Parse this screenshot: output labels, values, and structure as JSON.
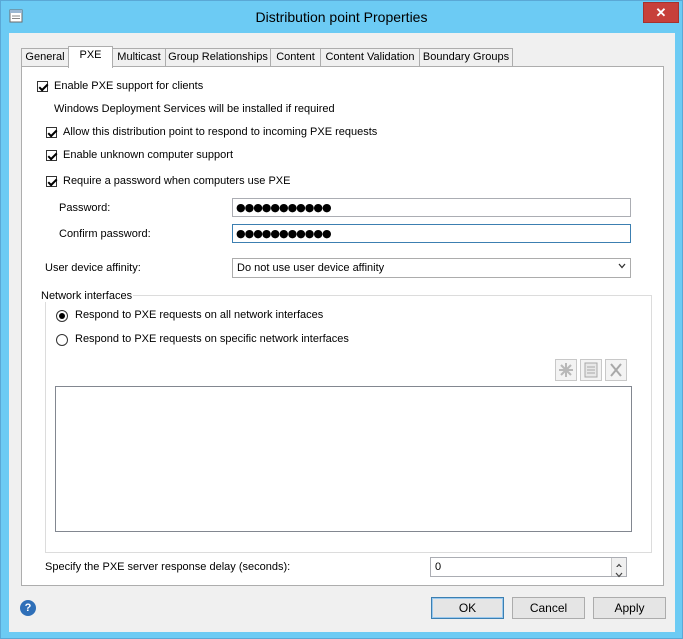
{
  "window": {
    "title": "Distribution point Properties",
    "close_glyph": "✕"
  },
  "tabs": [
    {
      "label": "General"
    },
    {
      "label": "PXE"
    },
    {
      "label": "Multicast"
    },
    {
      "label": "Group Relationships"
    },
    {
      "label": "Content"
    },
    {
      "label": "Content Validation"
    },
    {
      "label": "Boundary Groups"
    }
  ],
  "pxe": {
    "enable_label": "Enable PXE support for clients",
    "enable_checked": true,
    "wds_note": "Windows Deployment Services will be installed if required",
    "allow_label": "Allow this distribution point to respond to incoming PXE requests",
    "allow_checked": true,
    "unknown_label": "Enable unknown computer support",
    "unknown_checked": true,
    "require_pw_label": "Require a password when computers use PXE",
    "require_pw_checked": true,
    "password_label": "Password:",
    "password_value": "●●●●●●●●●●●",
    "confirm_label": "Confirm password:",
    "confirm_value": "●●●●●●●●●●●",
    "affinity_label": "User device affinity:",
    "affinity_value": "Do not use user device affinity",
    "network_group_label": "Network interfaces",
    "radio_all_label": "Respond to PXE requests on all network interfaces",
    "radio_all_selected": true,
    "radio_specific_label": "Respond to PXE requests on specific network interfaces",
    "radio_specific_selected": false,
    "delay_label": "Specify the PXE server response delay (seconds):",
    "delay_value": "0"
  },
  "buttons": {
    "ok": "OK",
    "cancel": "Cancel",
    "apply": "Apply"
  },
  "icons": {
    "help": "?"
  }
}
